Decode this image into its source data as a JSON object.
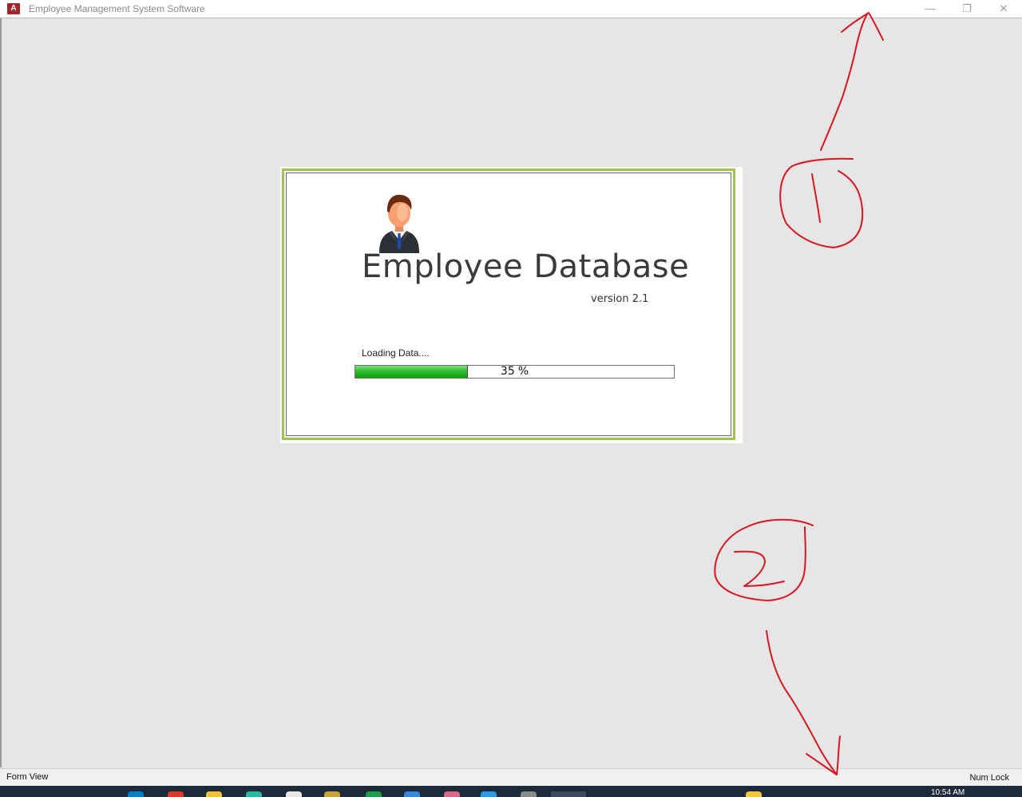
{
  "window": {
    "title": "Employee Management System Software",
    "app_icon_label": "A",
    "minimize_glyph": "—",
    "maximize_glyph": "❐",
    "close_glyph": "✕"
  },
  "splash": {
    "heading": "Employee Database",
    "version": "version 2.1",
    "loading_label": "Loading Data....",
    "progress_value": "35",
    "progress_unit": "%",
    "progress_fraction": 0.35,
    "avatar_icon": "businessman-avatar-icon",
    "colors": {
      "frame": "#9cc84a",
      "progress": "#2fbf2f"
    }
  },
  "statusbar": {
    "left": "Form View",
    "right": "Num Lock"
  },
  "taskbar": {
    "clock": "10:54 AM"
  },
  "annotations": {
    "color": "#e0141e"
  }
}
